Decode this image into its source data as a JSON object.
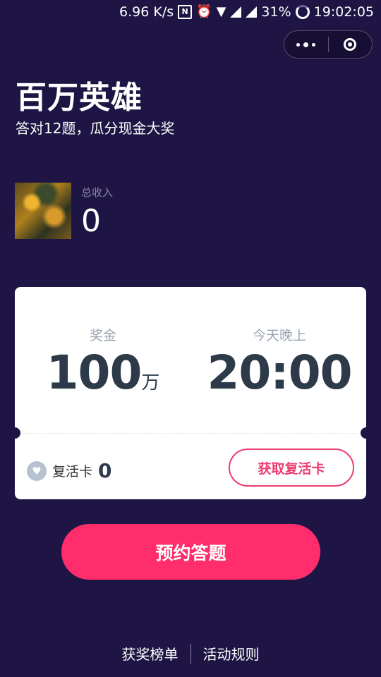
{
  "status_bar": {
    "network_speed": "6.96 K/s",
    "battery": "31%",
    "time": "19:02:05",
    "nfc_icon_text": "N"
  },
  "header": {
    "title": "百万英雄",
    "subtitle": "答对12题，瓜分现金大奖"
  },
  "income": {
    "label": "总收入",
    "value": "0"
  },
  "card": {
    "prize_label": "奖金",
    "prize_value": "100",
    "prize_unit": "万",
    "time_label": "今天晚上",
    "time_value": "20:00",
    "revive_label": "复活卡",
    "revive_count": "0",
    "get_revive_button": "获取复活卡"
  },
  "actions": {
    "reserve_button": "预约答题"
  },
  "footer": {
    "leaderboard": "获奖榜单",
    "rules": "活动规则"
  },
  "colors": {
    "background": "#1f1544",
    "accent": "#ff2d6c",
    "outline_button": "#ec3d6f"
  },
  "icons": [
    "nfc-icon",
    "alarm-icon",
    "wifi-icon",
    "signal-icon",
    "loading-icon",
    "more-icon",
    "close-target-icon",
    "heart-icon"
  ]
}
